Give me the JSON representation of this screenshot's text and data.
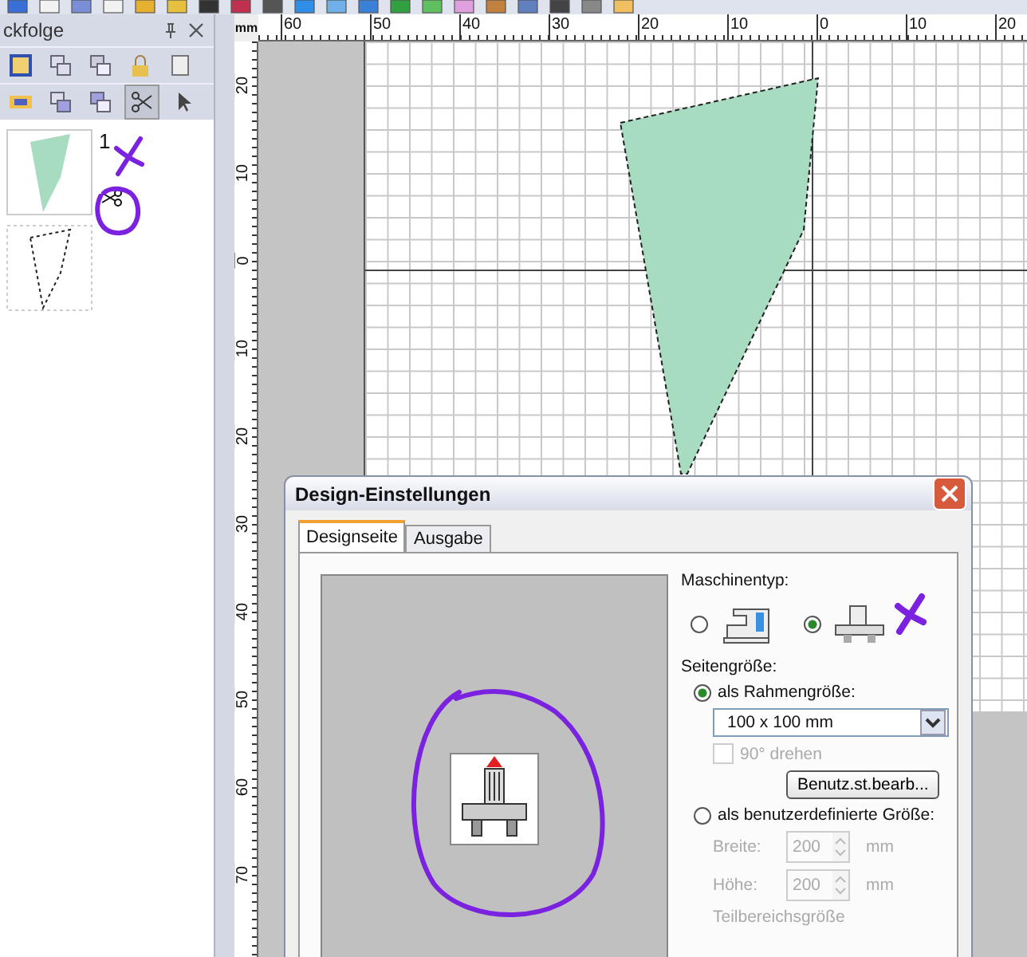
{
  "panel": {
    "title": "ckfolge",
    "items": [
      {
        "kind": "fill",
        "number": "1"
      },
      {
        "kind": "outline"
      }
    ]
  },
  "ruler": {
    "unit": "mm",
    "x_labels": [
      "60",
      "50",
      "40",
      "30",
      "20",
      "10",
      "0",
      "10",
      "20"
    ],
    "y_labels": [
      "20",
      "10",
      "0",
      "10",
      "20",
      "30",
      "40",
      "50",
      "60",
      "70"
    ]
  },
  "dialog": {
    "title": "Design-Einstellungen",
    "tabs": [
      {
        "label": "Designseite",
        "selected": true
      },
      {
        "label": "Ausgabe",
        "selected": false
      }
    ],
    "machine_type": {
      "label": "Maschinentyp:",
      "options": [
        {
          "kind": "sewing",
          "selected": false
        },
        {
          "kind": "embroidery",
          "selected": true
        }
      ]
    },
    "page_size": {
      "label": "Seitengröße:",
      "frame_option": {
        "label": "als Rahmengröße:",
        "selected": true
      },
      "frame_size": "100 x 100 mm",
      "rotate": {
        "label": "90° drehen",
        "checked": false,
        "disabled": true
      },
      "edit_button": "Benutz.st.bearb...",
      "custom_option": {
        "label": "als benutzerdefinierte Größe:",
        "selected": false
      },
      "fields": [
        {
          "label": "Breite:",
          "value": "200",
          "unit": "mm",
          "disabled": true
        },
        {
          "label": "Höhe:",
          "value": "200",
          "unit": "mm",
          "disabled": true
        }
      ],
      "partial_label": "Teilbereichsgröße"
    }
  }
}
